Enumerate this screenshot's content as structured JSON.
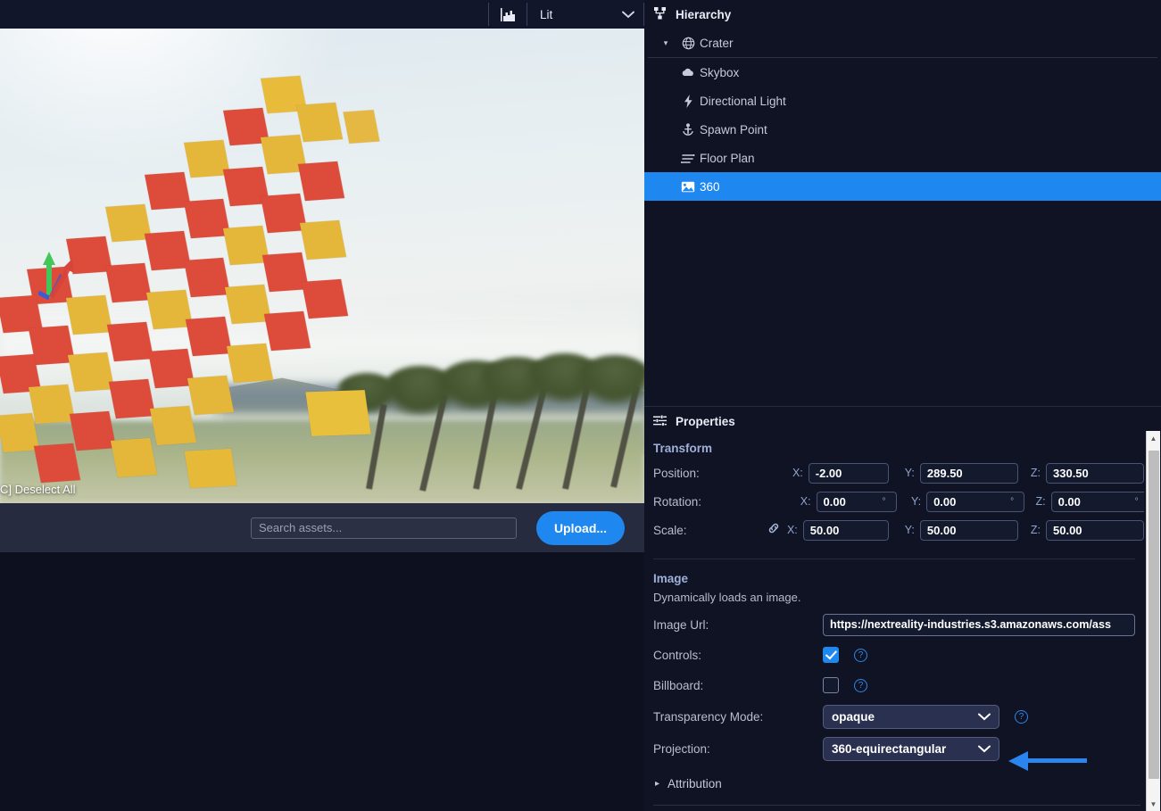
{
  "toolbar": {
    "shading_icon": "chart-icon",
    "shading_mode": "Lit",
    "chevron": "⌄"
  },
  "viewport": {
    "overlay_text": "C] Deselect All",
    "scene_desc": "3D beach scene with yellow and red cards",
    "gizmo": "translate-gizmo"
  },
  "assetbar": {
    "search_placeholder": "Search assets...",
    "search_value": "",
    "upload_label": "Upload..."
  },
  "hierarchy": {
    "title": "Hierarchy",
    "icon": "sitemap-icon",
    "items": [
      {
        "label": "Crater",
        "icon": "globe-icon",
        "depth": 0,
        "caret": "▾",
        "selected": false
      },
      {
        "label": "Skybox",
        "icon": "cloud-icon",
        "depth": 1,
        "caret": "",
        "selected": false
      },
      {
        "label": "Directional Light",
        "icon": "bolt-icon",
        "depth": 1,
        "caret": "",
        "selected": false
      },
      {
        "label": "Spawn Point",
        "icon": "anchor-icon",
        "depth": 1,
        "caret": "",
        "selected": false
      },
      {
        "label": "Floor Plan",
        "icon": "floorplan-icon",
        "depth": 1,
        "caret": "",
        "selected": false
      },
      {
        "label": "360",
        "icon": "image-icon",
        "depth": 1,
        "caret": "",
        "selected": true
      }
    ]
  },
  "properties": {
    "title": "Properties",
    "icon": "sliders-icon",
    "transform": {
      "section_label": "Transform",
      "position_label": "Position:",
      "rotation_label": "Rotation:",
      "scale_label": "Scale:",
      "x_label": "X:",
      "y_label": "Y:",
      "z_label": "Z:",
      "degree": "°",
      "link_icon": "link-icon",
      "position": {
        "x": "-2.00",
        "y": "289.50",
        "z": "330.50"
      },
      "rotation": {
        "x": "0.00",
        "y": "0.00",
        "z": "0.00"
      },
      "scale": {
        "x": "50.00",
        "y": "50.00",
        "z": "50.00"
      }
    },
    "image": {
      "section_label": "Image",
      "description": "Dynamically loads an image.",
      "url_label": "Image Url:",
      "url_value": "https://nextreality-industries.s3.amazonaws.com/ass",
      "controls_label": "Controls:",
      "controls_checked": true,
      "billboard_label": "Billboard:",
      "billboard_checked": false,
      "transparency_label": "Transparency Mode:",
      "transparency_value": "opaque",
      "projection_label": "Projection:",
      "projection_value": "360-equirectangular",
      "help_icon": "question-circle-icon",
      "chevron": "⌄"
    },
    "attribution": {
      "label": "Attribution",
      "caret": "▸"
    }
  },
  "scrollbar": {
    "up": "▲",
    "down": "▼"
  },
  "annotation": {
    "type": "arrow-left",
    "color": "#2a86ee"
  },
  "colors": {
    "accent": "#1e88f0",
    "panel_bg": "#0f1324",
    "toolbar_bg": "#11162a",
    "assetbar_bg": "#262b3f",
    "select_bg": "#2a3150"
  }
}
